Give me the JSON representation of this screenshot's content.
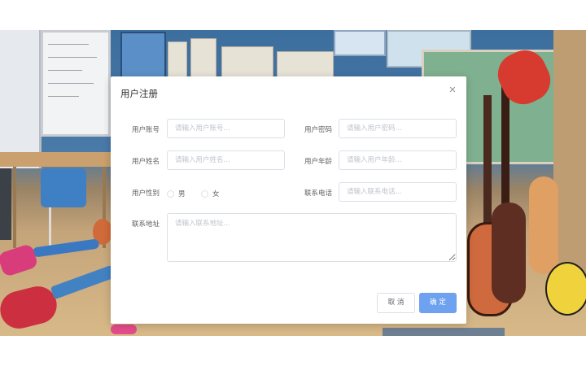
{
  "dialog": {
    "title": "用户注册",
    "close_icon": "close-icon"
  },
  "form": {
    "account": {
      "label": "用户账号",
      "placeholder": "请输入用户账号...",
      "value": ""
    },
    "password": {
      "label": "用户密码",
      "placeholder": "请输入用户密码...",
      "value": ""
    },
    "name": {
      "label": "用户姓名",
      "placeholder": "请输入用户姓名...",
      "value": ""
    },
    "age": {
      "label": "用户年龄",
      "placeholder": "请输入用户年龄...",
      "value": ""
    },
    "gender": {
      "label": "用户性别",
      "options": [
        "男",
        "女"
      ],
      "selected": ""
    },
    "phone": {
      "label": "联系电话",
      "placeholder": "请输入联系电话...",
      "value": ""
    },
    "address": {
      "label": "联系地址",
      "placeholder": "请输入联系地址...",
      "value": ""
    }
  },
  "footer": {
    "cancel_label": "取 消",
    "confirm_label": "确 定"
  },
  "colors": {
    "primary": "#6ea1f0",
    "border": "#dcdfe6",
    "placeholder": "#c0c4cc",
    "label": "#606266"
  }
}
